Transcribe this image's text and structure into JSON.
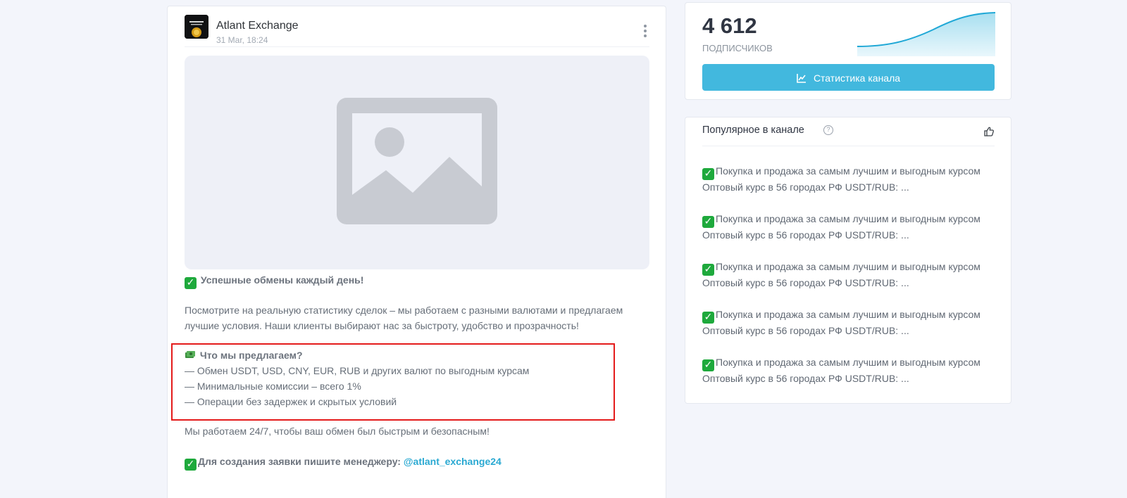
{
  "post": {
    "channel_name": "Atlant Exchange",
    "date": "31 Mar, 18:24",
    "menu_icon": "more-vertical-icon",
    "media_icon": "image-placeholder-icon",
    "headline": "Успешные обмены каждый день!",
    "intro_line_1": "Посмотрите на реальную статистику сделок – мы работаем с разными валютами и предлагаем",
    "intro_line_2": "лучшие условия. Наши клиенты выбирают нас за быстроту, удобство и прозрачность!",
    "offer_title": "Что мы предлагаем?",
    "offers": [
      "— Обмен USDT, USD, CNY, EUR, RUB и других валют по выгодным курсам",
      "— Минимальные комиссии – всего 1%",
      "— Операции без задержек и скрытых условий"
    ],
    "closing": "Мы работаем 24/7, чтобы ваш обмен был быстрым и безопасным!",
    "cta": "Для создания заявки пишите менеджеру: ",
    "mention": "@atlant_exchange24",
    "check_icon": "check-mark-emoji",
    "money_icon": "money-emoji"
  },
  "stats": {
    "subscribers": "4 612",
    "subscribers_label": "ПОДПИСЧИКОВ",
    "button_label": "Статистика канала",
    "button_icon": "line-chart-icon",
    "accent_color": "#42b8de"
  },
  "popular": {
    "title": "Популярное в канале",
    "help_icon": "question-circle-icon",
    "thumb_icon": "thumb-up-icon",
    "items": [
      {
        "line_1": "Покупка и продажа за самым лучшим и выгодным курсом",
        "line_2": "Оптовый курс в 56 городах РФ USDT/RUB: ..."
      },
      {
        "line_1": "Покупка и продажа за самым лучшим и выгодным курсом",
        "line_2": "Оптовый курс в 56 городах РФ USDT/RUB: ..."
      },
      {
        "line_1": "Покупка и продажа за самым лучшим и выгодным курсом",
        "line_2": "Оптовый курс в 56 городах РФ USDT/RUB: ..."
      },
      {
        "line_1": "Покупка и продажа за самым лучшим и выгодным курсом",
        "line_2": "Оптовый курс в 56 городах РФ USDT/RUB: ..."
      },
      {
        "line_1": "Покупка и продажа за самым лучшим и выгодным курсом",
        "line_2": "Оптовый курс в 56 городах РФ USDT/RUB: ..."
      }
    ]
  }
}
